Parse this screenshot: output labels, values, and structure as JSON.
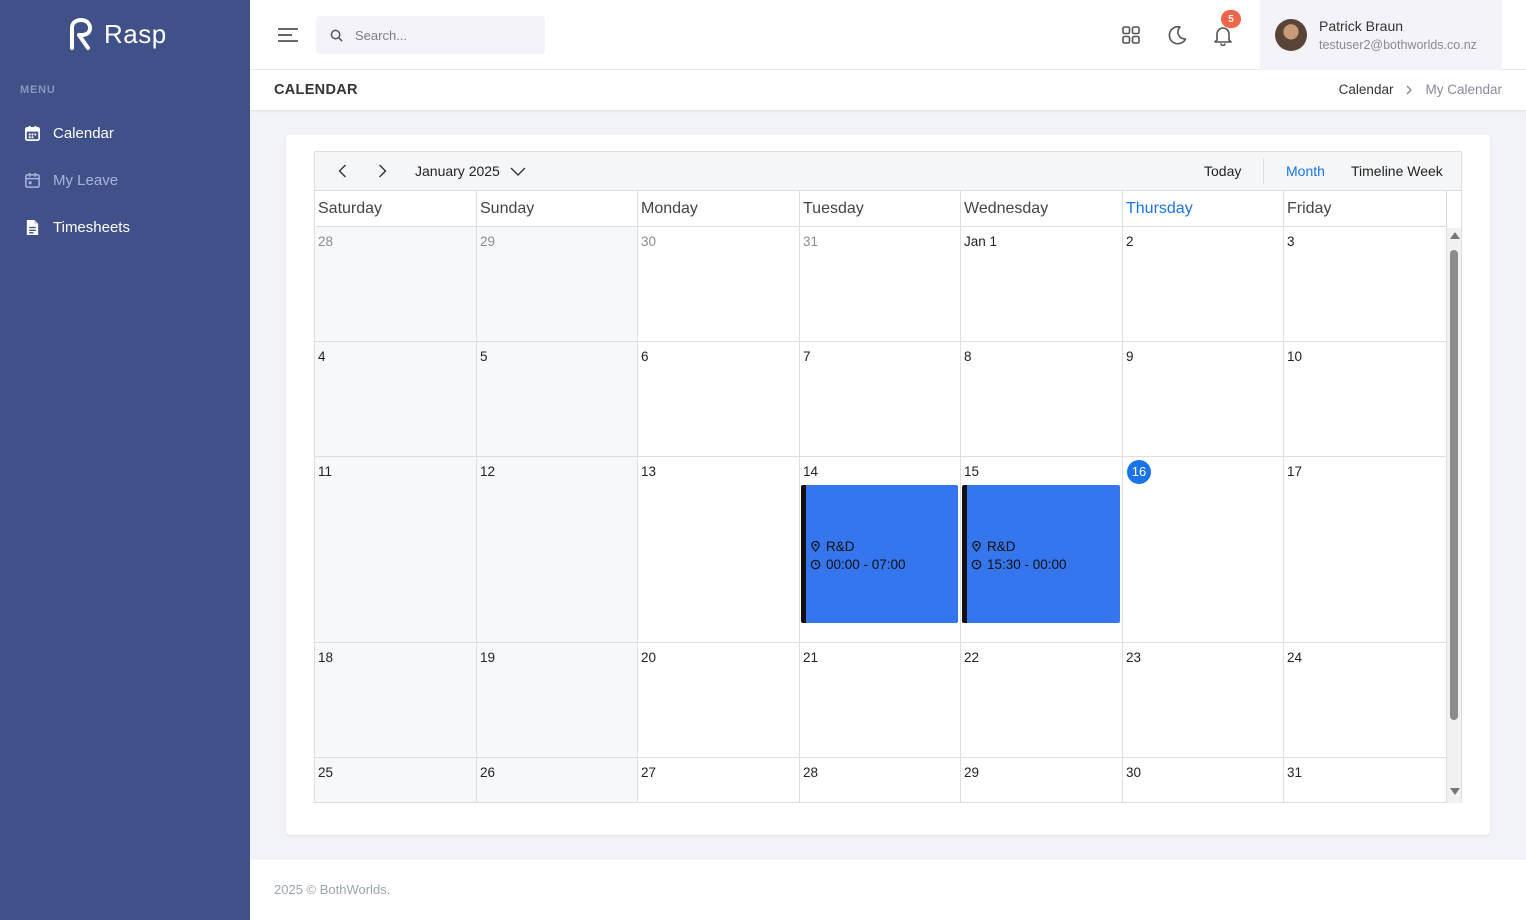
{
  "brand": {
    "name": "Rasp"
  },
  "sidebar": {
    "menu_title": "MENU",
    "items": [
      {
        "label": "Calendar",
        "icon": "calendar-icon"
      },
      {
        "label": "My Leave",
        "icon": "calendar-icon"
      },
      {
        "label": "Timesheets",
        "icon": "document-icon"
      }
    ]
  },
  "topbar": {
    "search_placeholder": "Search...",
    "notification_count": "5",
    "user": {
      "name": "Patrick Braun",
      "email": "testuser2@bothworlds.co.nz"
    }
  },
  "page": {
    "title": "CALENDAR",
    "breadcrumb": [
      "Calendar",
      "My Calendar"
    ]
  },
  "calendar": {
    "period": "January 2025",
    "buttons": {
      "today": "Today",
      "month": "Month",
      "timeline_week": "Timeline Week"
    },
    "weekdays": [
      "Saturday",
      "Sunday",
      "Monday",
      "Tuesday",
      "Wednesday",
      "Thursday",
      "Friday"
    ],
    "rows": [
      [
        "28",
        "29",
        "30",
        "31",
        "Jan 1",
        "2",
        "3"
      ],
      [
        "4",
        "5",
        "6",
        "7",
        "8",
        "9",
        "10"
      ],
      [
        "11",
        "12",
        "13",
        "14",
        "15",
        "16",
        "17"
      ],
      [
        "18",
        "19",
        "20",
        "21",
        "22",
        "23",
        "24"
      ],
      [
        "25",
        "26",
        "27",
        "28",
        "29",
        "30",
        "31"
      ]
    ],
    "today": "16",
    "events": [
      {
        "location": "R&D",
        "time": "00:00 - 07:00"
      },
      {
        "location": "R&D",
        "time": "15:30 - 00:00"
      }
    ],
    "colors": {
      "event": "#3575ee",
      "accent": "#1a73e8"
    }
  },
  "footer": {
    "text": "2025 © BothWorlds."
  }
}
